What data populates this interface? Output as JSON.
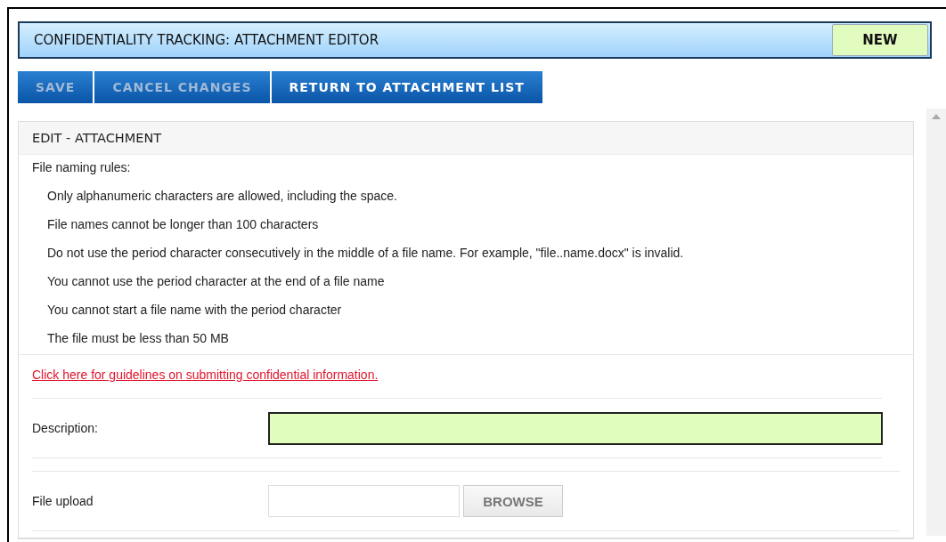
{
  "header": {
    "title": "CONFIDENTIALITY TRACKING: ATTACHMENT EDITOR",
    "status": "NEW"
  },
  "toolbar": [
    {
      "label": "SAVE",
      "disabled": true
    },
    {
      "label": "CANCEL CHANGES",
      "disabled": true
    },
    {
      "label": "RETURN TO ATTACHMENT LIST",
      "disabled": false
    }
  ],
  "panel": {
    "title": "EDIT - ATTACHMENT",
    "rules_heading": "File naming rules:",
    "rules": [
      "Only alphanumeric characters are allowed, including the space.",
      "File names cannot be longer than 100 characters",
      "Do not use the period character consecutively in the middle of a file name. For example, \"file..name.docx\" is invalid.",
      "You cannot use the period character at the end of a file name",
      "You cannot start a file name with the period character",
      "The file must be less than 50 MB"
    ],
    "guidelines_link": "Click here for guidelines on submitting confidential information.",
    "description": {
      "label": "Description:",
      "focused": true
    },
    "file_upload": {
      "label": "File upload",
      "button": "BROWSE"
    }
  }
}
